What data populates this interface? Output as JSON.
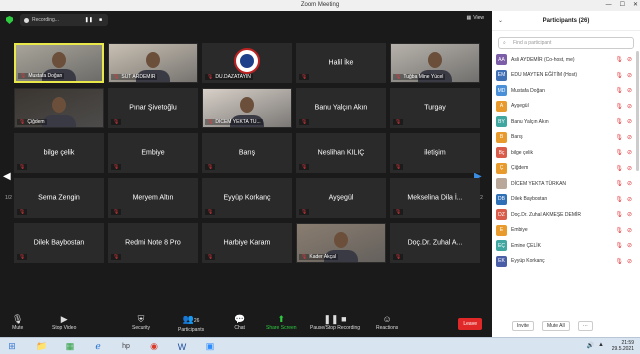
{
  "window": {
    "title": "Zoom Meeting",
    "controls": [
      "—",
      "☐",
      "✕"
    ]
  },
  "topbar": {
    "recording_label": "Recording...",
    "view_label": "View"
  },
  "tiles": [
    {
      "name": "Mustafa Doğan",
      "caption": "Mustafa Doğan",
      "type": "video",
      "bg": "#a8a49a",
      "active": true
    },
    {
      "name": "SUT ARDEMİR",
      "caption": "SUT ARDEMİR",
      "type": "video",
      "bg": "#c9c0b3",
      "active": false
    },
    {
      "name": "DUDAZATAYIN",
      "caption": "DU.DAZATAYIN",
      "type": "logo",
      "bg": "#2a2a2a",
      "active": false
    },
    {
      "name": "Halil İke",
      "caption": "",
      "type": "name",
      "bg": "#2a2a2a",
      "active": false
    },
    {
      "name": "Tuğba Mine Yücel",
      "caption": "Tuğba Mine Yücel",
      "type": "video",
      "bg": "#b7b2ab",
      "active": false
    },
    {
      "name": "Çiğdem",
      "caption": "Çiğdem",
      "type": "video",
      "bg": "#3a3530",
      "active": false
    },
    {
      "name": "Pınar Şivetoğlu",
      "caption": "",
      "type": "name",
      "bg": "#2a2a2a",
      "active": false
    },
    {
      "name": "DİCEM YEKTA TÜRKAN",
      "caption": "DİCEM YEKTA TÜ...",
      "type": "video",
      "bg": "#d8d0c8",
      "active": false
    },
    {
      "name": "Banu Yalçın Akın",
      "caption": "",
      "type": "name",
      "bg": "#2a2a2a",
      "active": false
    },
    {
      "name": "Turgay",
      "caption": "",
      "type": "name",
      "bg": "#2a2a2a",
      "active": false
    },
    {
      "name": "bilge çelik",
      "caption": "",
      "type": "name",
      "bg": "#2a2a2a",
      "active": false
    },
    {
      "name": "Embiye",
      "caption": "",
      "type": "name",
      "bg": "#2a2a2a",
      "active": false
    },
    {
      "name": "Barış",
      "caption": "",
      "type": "name",
      "bg": "#2a2a2a",
      "active": false
    },
    {
      "name": "Neslihan KILIÇ",
      "caption": "",
      "type": "name",
      "bg": "#2a2a2a",
      "active": false
    },
    {
      "name": "iletişim",
      "caption": "",
      "type": "name",
      "bg": "#2a2a2a",
      "active": false
    },
    {
      "name": "Sema Zengin",
      "caption": "",
      "type": "name",
      "bg": "#2a2a2a",
      "active": false
    },
    {
      "name": "Meryem Altın",
      "caption": "",
      "type": "name",
      "bg": "#2a2a2a",
      "active": false
    },
    {
      "name": "Eyyüp Korkanç",
      "caption": "",
      "type": "name",
      "bg": "#2a2a2a",
      "active": false
    },
    {
      "name": "Ayşegül",
      "caption": "",
      "type": "name",
      "bg": "#2a2a2a",
      "active": false
    },
    {
      "name": "Mekselina Dila İ...",
      "caption": "",
      "type": "name",
      "bg": "#2a2a2a",
      "active": false
    },
    {
      "name": "Dilek Baybostan",
      "caption": "",
      "type": "name",
      "bg": "#2a2a2a",
      "active": false
    },
    {
      "name": "Redmi Note 8 Pro",
      "caption": "",
      "type": "name",
      "bg": "#2a2a2a",
      "active": false
    },
    {
      "name": "Harbiye Karam",
      "caption": "",
      "type": "name",
      "bg": "#2a2a2a",
      "active": false
    },
    {
      "name": "Kader Akçal",
      "caption": "Kader Akçal",
      "type": "video",
      "bg": "#8a7d70",
      "active": false
    },
    {
      "name": "Doç.Dr. Zuhal A...",
      "caption": "",
      "type": "name",
      "bg": "#2a2a2a",
      "active": false
    }
  ],
  "pager": {
    "left": "1/2",
    "right": "1/2"
  },
  "toolbar": {
    "mute": "Mute",
    "stop_video": "Stop Video",
    "security": "Security",
    "participants": "Participants",
    "participants_count": "26",
    "chat": "Chat",
    "share_screen": "Share Screen",
    "pause_recording": "Pause/Stop Recording",
    "reactions": "Reactions",
    "leave": "Leave"
  },
  "panel": {
    "title": "Participants (26)",
    "search_placeholder": "Find a participant",
    "participants": [
      {
        "initials": "AA",
        "name": "Asli AYDEMİR (Co-host, me)",
        "color": "#7b5ea7"
      },
      {
        "initials": "EM",
        "name": "EDU MAYTEN EĞİTİM (Host)",
        "color": "#3f6fb5"
      },
      {
        "initials": "MD",
        "name": "Mustafa Doğan",
        "color": "#4a90d9"
      },
      {
        "initials": "A",
        "name": "Ayşegül",
        "color": "#e89b2c"
      },
      {
        "initials": "BY",
        "name": "Banu Yalçın Akın",
        "color": "#3fa7a0"
      },
      {
        "initials": "B",
        "name": "Barış",
        "color": "#e89b2c"
      },
      {
        "initials": "Bç",
        "name": "bilge çelik",
        "color": "#d95c4a"
      },
      {
        "initials": "Ç",
        "name": "Çiğdem",
        "color": "#e89b2c"
      },
      {
        "initials": "",
        "name": "DİCEM YEKTA TÜRKAN",
        "color": "#b9a89a"
      },
      {
        "initials": "DB",
        "name": "Dilek Baybostan",
        "color": "#2e6fb5"
      },
      {
        "initials": "DZ",
        "name": "Doç.Dr. Zuhal AKMEŞE DEMİR",
        "color": "#d95c4a"
      },
      {
        "initials": "E",
        "name": "Embiye",
        "color": "#e89b2c"
      },
      {
        "initials": "EÇ",
        "name": "Emine ÇELİK",
        "color": "#3fa7a0"
      },
      {
        "initials": "EK",
        "name": "Eyyüp Korkanç",
        "color": "#4a5ea8"
      }
    ],
    "invite": "Invite",
    "mute_all": "Mute All",
    "more": "···"
  },
  "taskbar": {
    "time": "21:59",
    "date": "29.5.2021"
  }
}
